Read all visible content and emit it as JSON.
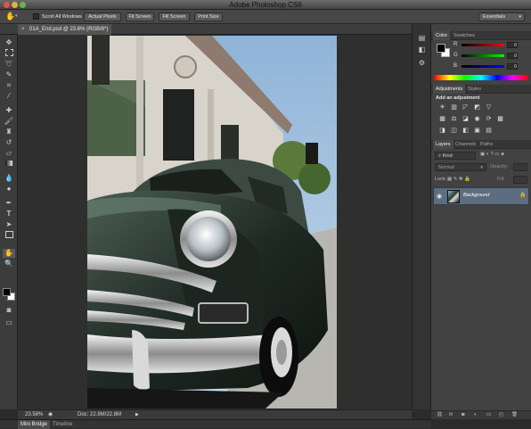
{
  "window": {
    "title": "Adobe Photoshop CS6"
  },
  "options_bar": {
    "scroll_all_windows": "Scroll All Windows",
    "actual_pixels": "Actual Pixels",
    "fit_screen": "Fit Screen",
    "fill_screen": "Fill Screen",
    "print_size": "Print Size",
    "workspace": "Essentials"
  },
  "document": {
    "tab_title": "01A_End.psd @ 23.6% (RGB/8*)",
    "close_glyph": "×"
  },
  "status_bar": {
    "zoom": "23.58%",
    "doc_info": "Doc: 22.8M/22.8M"
  },
  "bottom_tabs": {
    "mini_bridge": "Mini Bridge",
    "timeline": "Timeline"
  },
  "color_panel": {
    "tabs": [
      "Color",
      "Swatches"
    ],
    "channels": [
      {
        "label": "R",
        "value": "0"
      },
      {
        "label": "G",
        "value": "0"
      },
      {
        "label": "B",
        "value": "0"
      }
    ]
  },
  "adjustments_panel": {
    "tabs": [
      "Adjustments",
      "Styles"
    ],
    "heading": "Add an adjustment"
  },
  "layers_panel": {
    "tabs": [
      "Layers",
      "Channels",
      "Paths"
    ],
    "filter_kind": "Kind",
    "blend_mode": "Normal",
    "opacity_label": "Opacity:",
    "lock_label": "Lock:",
    "fill_label": "Fill:",
    "layers": [
      {
        "name": "Background",
        "visible": true,
        "locked": true
      }
    ]
  },
  "icons": {
    "toolbar": [
      "move-tool-icon",
      "marquee-tool-icon",
      "lasso-tool-icon",
      "quick-select-tool-icon",
      "crop-tool-icon",
      "eyedropper-tool-icon",
      "healing-brush-tool-icon",
      "brush-tool-icon",
      "clone-stamp-tool-icon",
      "history-brush-tool-icon",
      "eraser-tool-icon",
      "gradient-tool-icon",
      "blur-tool-icon",
      "dodge-tool-icon",
      "pen-tool-icon",
      "type-tool-icon",
      "path-select-tool-icon",
      "rectangle-tool-icon",
      "hand-tool-icon",
      "zoom-tool-icon"
    ]
  },
  "colors": {
    "chrome_dark": "#2b2b2b",
    "panel": "#424242",
    "accent_selected_layer": "#5d6d80",
    "spectrum": "rainbow"
  }
}
